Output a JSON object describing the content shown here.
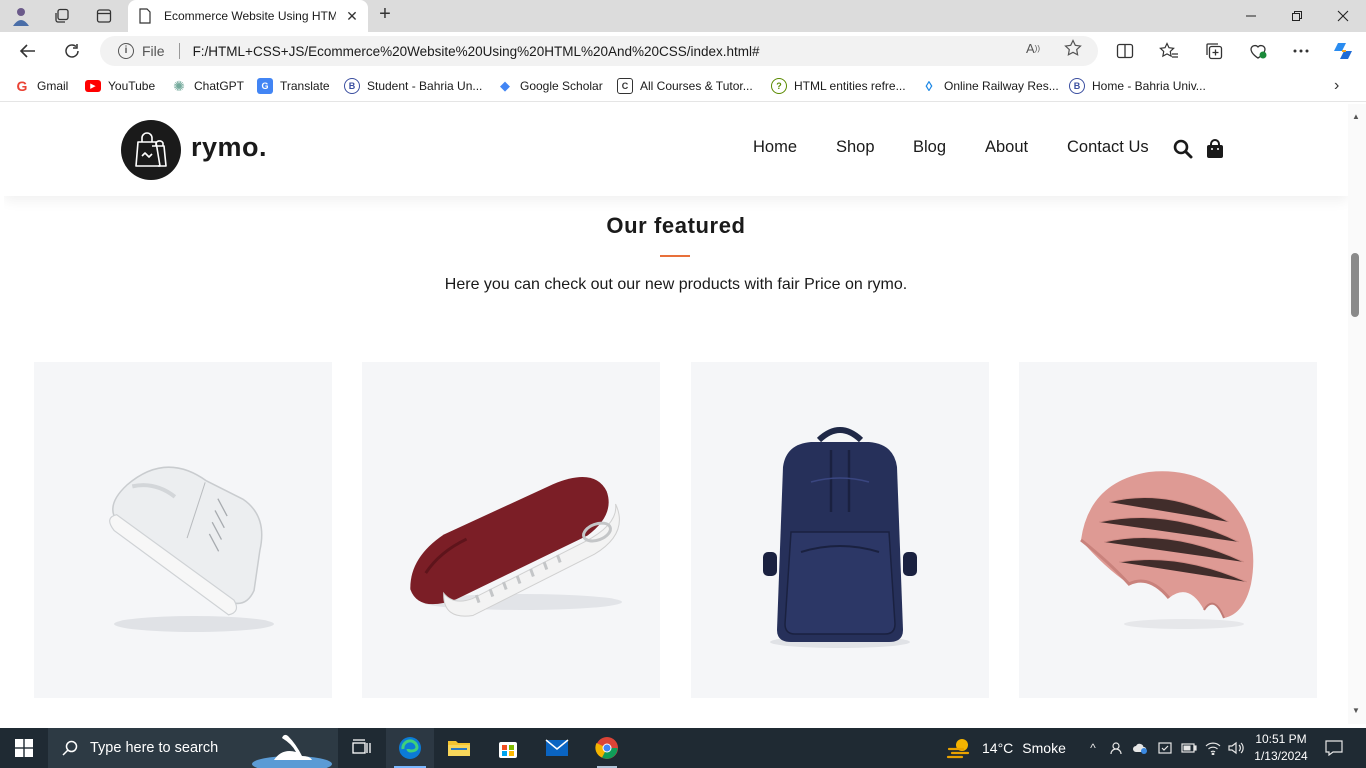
{
  "browser": {
    "tab_title": "Ecommerce Website Using HTML",
    "url_scheme_label": "File",
    "url": "F:/HTML+CSS+JS/Ecommerce%20Website%20Using%20HTML%20And%20CSS/index.html#",
    "bookmarks": [
      {
        "label": "Gmail",
        "icon": "gmail-icon",
        "color": "#ea4335",
        "glyph": "G"
      },
      {
        "label": "YouTube",
        "icon": "youtube-icon",
        "color": "#ff0000",
        "glyph": "▶"
      },
      {
        "label": "ChatGPT",
        "icon": "chatgpt-icon",
        "color": "#74aa9c",
        "glyph": "✺"
      },
      {
        "label": "Translate",
        "icon": "translate-icon",
        "color": "#4285f4",
        "glyph": "G"
      },
      {
        "label": "Student - Bahria Un...",
        "icon": "bahria-icon",
        "color": "#3b4fa0",
        "glyph": "B"
      },
      {
        "label": "Google Scholar",
        "icon": "scholar-icon",
        "color": "#4285f4",
        "glyph": "◆"
      },
      {
        "label": "All Courses & Tutor...",
        "icon": "courses-icon",
        "color": "#333333",
        "glyph": "C"
      },
      {
        "label": "HTML entities refre...",
        "icon": "question-icon",
        "color": "#5a8a00",
        "glyph": "?"
      },
      {
        "label": "Online Railway Res...",
        "icon": "drop-icon",
        "color": "#1e88e5",
        "glyph": "◊"
      },
      {
        "label": "Home - Bahria Univ...",
        "icon": "bahria-icon",
        "color": "#3b4fa0",
        "glyph": "B"
      }
    ]
  },
  "site": {
    "logo_text": "rymo.",
    "nav": [
      "Home",
      "Shop",
      "Blog",
      "About",
      "Contact Us"
    ],
    "featured_title": "Our featured",
    "featured_subtitle": "Here you can check out our new products with fair Price on rymo.",
    "accent_color": "#e8703a",
    "products": [
      {
        "image": "white-sneaker"
      },
      {
        "image": "maroon-sneaker-sole"
      },
      {
        "image": "navy-backpack"
      },
      {
        "image": "pink-beanie"
      }
    ]
  },
  "taskbar": {
    "search_placeholder": "Type here to search",
    "weather_temp": "14°C",
    "weather_text": "Smoke",
    "time": "10:51 PM",
    "date": "1/13/2024"
  }
}
